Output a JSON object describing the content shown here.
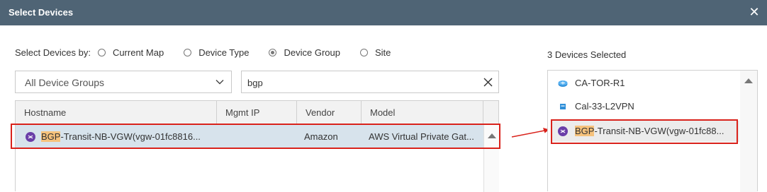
{
  "dialog": {
    "title": "Select Devices",
    "close_icon": "close-icon"
  },
  "select_by": {
    "label": "Select Devices by:",
    "options": [
      {
        "label": "Current Map",
        "selected": false
      },
      {
        "label": "Device Type",
        "selected": false
      },
      {
        "label": "Device Group",
        "selected": true
      },
      {
        "label": "Site",
        "selected": false
      }
    ]
  },
  "group_dropdown": {
    "value": "All Device Groups",
    "icon": "chevron-down-icon"
  },
  "search": {
    "value": "bgp",
    "clear_icon": "close-icon"
  },
  "table": {
    "columns": [
      "Hostname",
      "Mgmt IP",
      "Vendor",
      "Model"
    ],
    "rows": [
      {
        "hostname_match": "BGP",
        "hostname_rest": "-Transit-NB-VGW(vgw-01fc8816...",
        "mgmt_ip": "",
        "vendor": "Amazon",
        "model": "AWS Virtual Private Gat...",
        "icon": "vpn-gateway-icon"
      }
    ]
  },
  "selected_panel": {
    "count_label": "3 Devices Selected",
    "items": [
      {
        "label": "CA-TOR-R1",
        "icon": "router-icon"
      },
      {
        "label": "Cal-33-L2VPN",
        "icon": "switch-icon"
      },
      {
        "label_match": "BGP",
        "label_rest": "-Transit-NB-VGW(vgw-01fc88...",
        "icon": "vpn-gateway-icon"
      }
    ]
  },
  "colors": {
    "title_bar": "#4f6475",
    "row_selected": "#d7e3ec",
    "highlight": "#f6c27c",
    "annotation_red": "#d9221b",
    "gateway_icon": "#6a3ea8",
    "router_icon": "#2f8fd8"
  }
}
